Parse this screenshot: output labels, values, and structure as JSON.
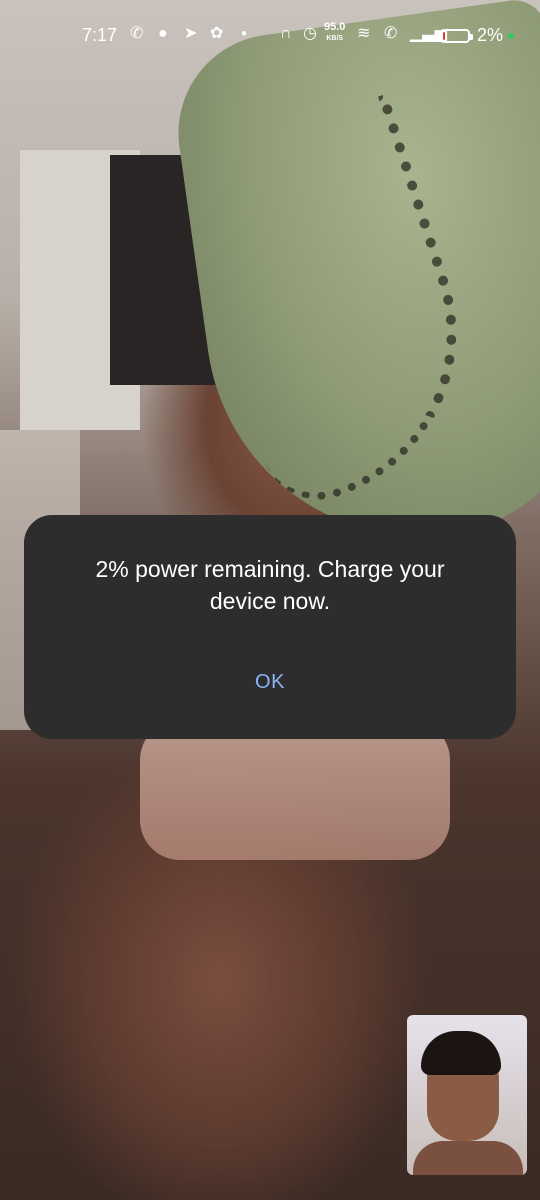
{
  "status_bar": {
    "time": "7:17",
    "speed_value": "95.0",
    "speed_unit": "KB/S",
    "battery_percent": "2%",
    "battery_level": 0.02,
    "battery_color": "#e53935",
    "icons": [
      "whatsapp-icon",
      "chat-icon",
      "telegram-icon",
      "app-icon",
      "dot-icon",
      "headphones-icon",
      "alarm-icon",
      "wifi-icon",
      "wifi-call-icon",
      "signal-icon",
      "battery-icon"
    ]
  },
  "dialog": {
    "message": "2% power remaining. Charge your device now.",
    "ok_label": "OK",
    "accent_color": "#8ab4f8"
  }
}
